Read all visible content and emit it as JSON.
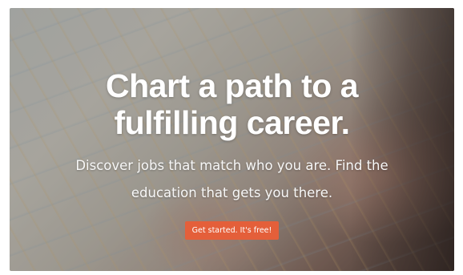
{
  "hero": {
    "headline_line1": "Chart a path to a",
    "headline_line2": "fulfilling career.",
    "subheadline_line1": "Discover jobs that match who you are. Find the",
    "subheadline_line2": "education that gets you there.",
    "cta_label": "Get started. It's free!"
  },
  "colors": {
    "cta_background": "#e45f3a",
    "text": "#ffffff"
  }
}
